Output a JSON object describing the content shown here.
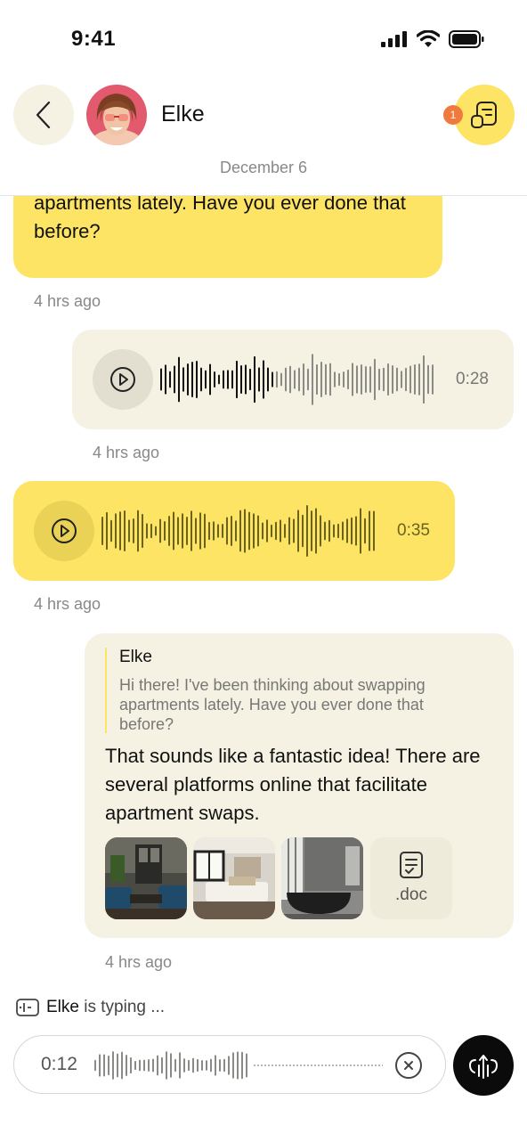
{
  "status_bar": {
    "time": "9:41"
  },
  "header": {
    "contact_name": "Elke",
    "notification_count": "1"
  },
  "date_separator": "December 6",
  "messages": [
    {
      "type": "text",
      "direction": "incoming",
      "text": "Hi there! I've been thinking about swapping apartments lately. Have you ever done that before?",
      "time": "4 hrs ago"
    },
    {
      "type": "voice",
      "direction": "outgoing",
      "duration": "0:28",
      "time": "4 hrs ago"
    },
    {
      "type": "voice",
      "direction": "incoming",
      "duration": "0:35",
      "time": "4 hrs ago"
    },
    {
      "type": "reply",
      "direction": "outgoing",
      "quoted_name": "Elke",
      "quoted_text": "Hi there! I've been thinking about swapping apartments lately. Have you ever done that before?",
      "text": "That sounds like a fantastic idea! There are several platforms online that facilitate apartment swaps.",
      "attachments": [
        "living-room-photo",
        "bedroom-photo",
        "bathroom-photo"
      ],
      "file_label": ".doc",
      "time": "4 hrs ago"
    }
  ],
  "typing_indicator": {
    "name": "Elke",
    "text": "is typing ..."
  },
  "recorder": {
    "elapsed": "0:12"
  },
  "colors": {
    "accent_yellow": "#fde465",
    "bubble_beige": "#f5f2e3",
    "badge_orange": "#f07a3e"
  }
}
